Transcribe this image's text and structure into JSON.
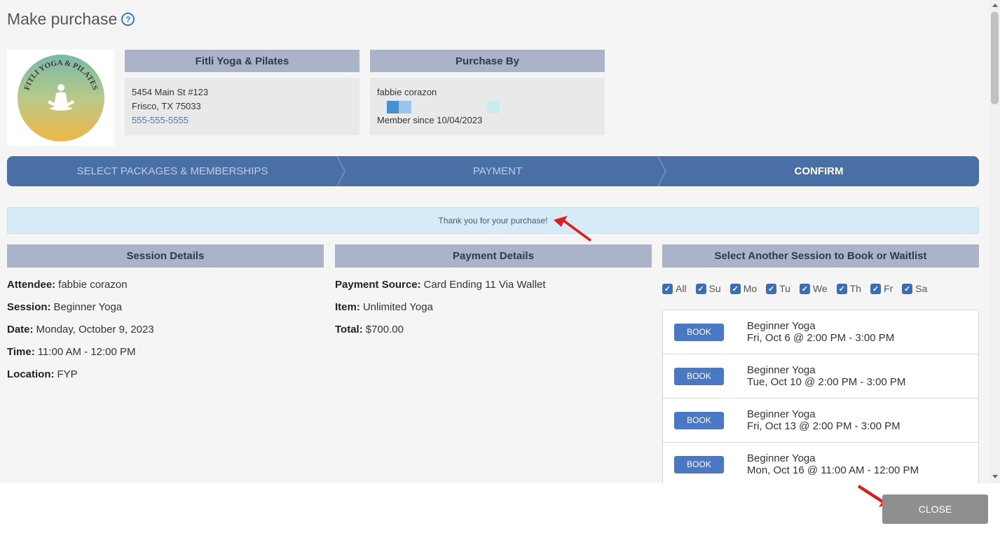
{
  "header": {
    "title": "Make purchase",
    "help_icon": "question-circle-icon"
  },
  "studio": {
    "name": "Fitli Yoga & Pilates",
    "address_line1": "5454 Main St #123",
    "address_line2": "Frisco, TX 75033",
    "phone": "555-555-5555",
    "logo_text_top": "FITLI YOGA & PILATES"
  },
  "purchaser": {
    "header": "Purchase By",
    "name": "fabbie corazon",
    "member_since": "Member since 10/04/2023"
  },
  "steps": [
    {
      "label": "SELECT PACKAGES & MEMBERSHIPS",
      "state": "done"
    },
    {
      "label": "PAYMENT",
      "state": "done"
    },
    {
      "label": "CONFIRM",
      "state": "active"
    }
  ],
  "notice": "Thank you for your purchase!",
  "session_details": {
    "header": "Session Details",
    "rows": [
      {
        "label": "Attendee:",
        "value": "fabbie corazon"
      },
      {
        "label": "Session:",
        "value": "Beginner Yoga"
      },
      {
        "label": "Date:",
        "value": "Monday, October 9, 2023"
      },
      {
        "label": "Time:",
        "value": "11:00 AM - 12:00 PM"
      },
      {
        "label": "Location:",
        "value": "FYP"
      }
    ]
  },
  "payment_details": {
    "header": "Payment Details",
    "rows": [
      {
        "label": "Payment Source:",
        "value": "Card Ending 11 Via Wallet"
      },
      {
        "label": "Item:",
        "value": "Unlimited Yoga"
      },
      {
        "label": "Total:",
        "value": "$700.00"
      }
    ]
  },
  "another_session": {
    "header": "Select Another Session to Book or Waitlist",
    "days": [
      "All",
      "Su",
      "Mo",
      "Tu",
      "We",
      "Th",
      "Fr",
      "Sa"
    ],
    "book_label": "BOOK",
    "sessions": [
      {
        "name": "Beginner Yoga",
        "when": "Fri, Oct 6 @ 2:00 PM - 3:00 PM"
      },
      {
        "name": "Beginner Yoga",
        "when": "Tue, Oct 10 @ 2:00 PM - 3:00 PM"
      },
      {
        "name": "Beginner Yoga",
        "when": "Fri, Oct 13 @ 2:00 PM - 3:00 PM"
      },
      {
        "name": "Beginner Yoga",
        "when": "Mon, Oct 16 @ 11:00 AM - 12:00 PM"
      }
    ]
  },
  "footer": {
    "close_label": "CLOSE"
  },
  "colors": {
    "accent": "#4a6fa5",
    "header_bg": "#aab3c8",
    "button_blue": "#4a78c2",
    "close_gray": "#8f8f8f",
    "notice_bg": "#d6ebf5",
    "annotation_arrow": "#e01b1b"
  }
}
